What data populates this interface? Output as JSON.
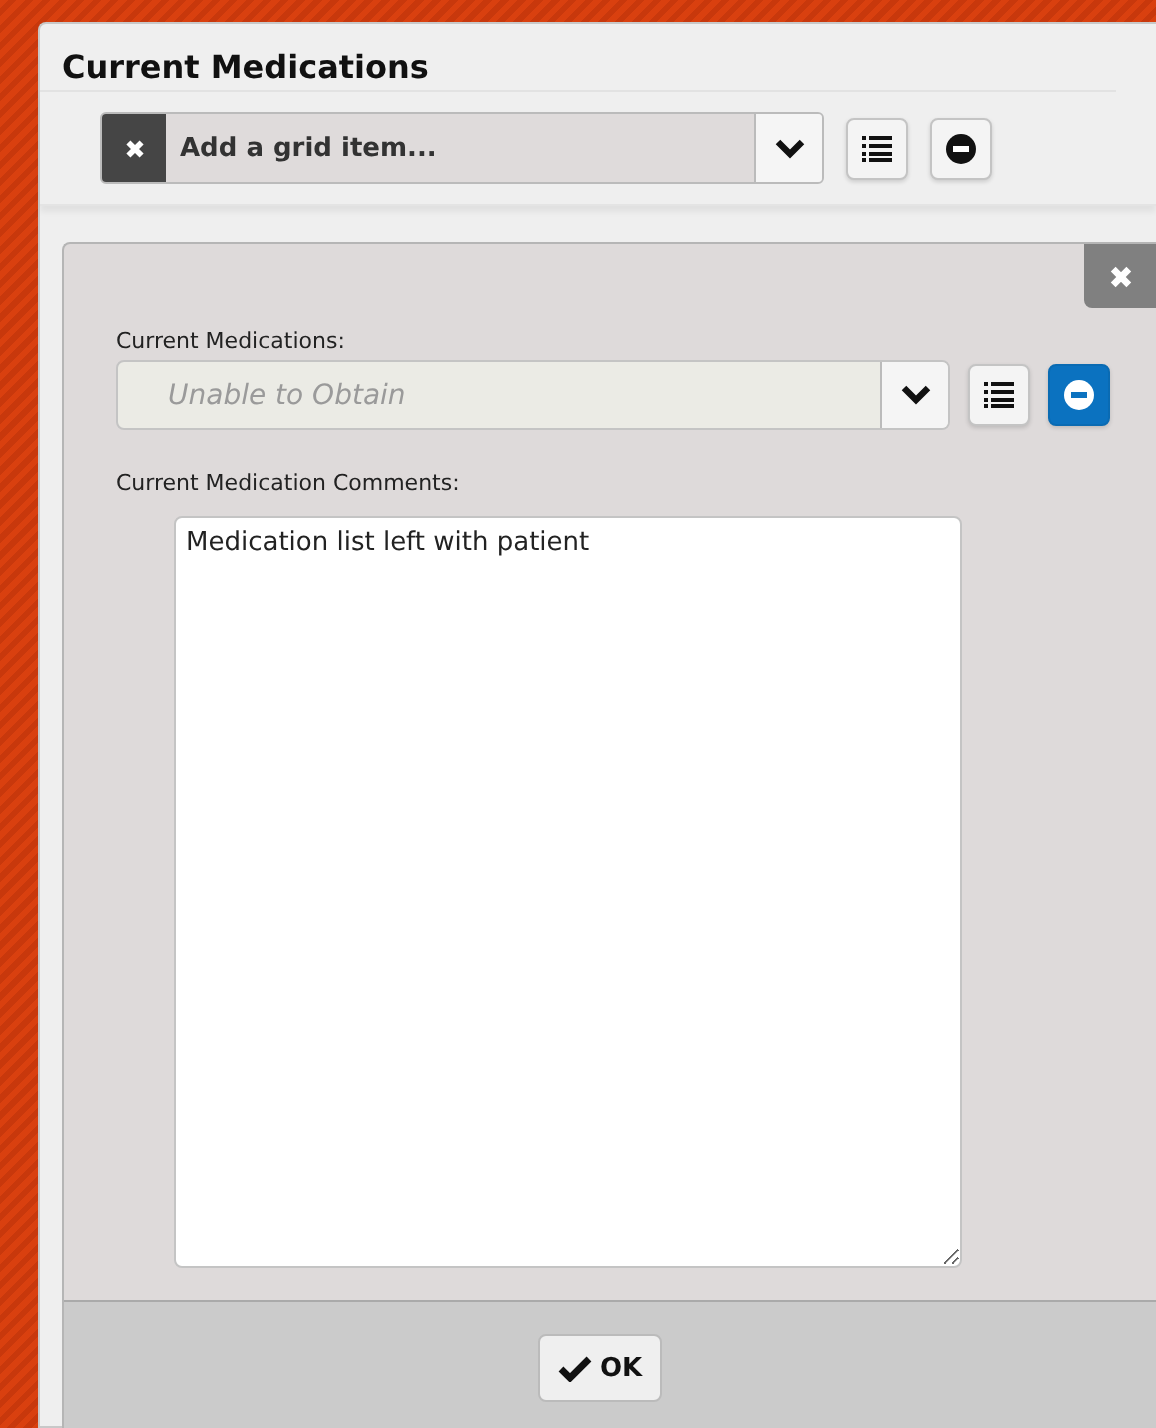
{
  "section": {
    "title": "Current Medications"
  },
  "add_bar": {
    "placeholder": "Add a grid item..."
  },
  "item": {
    "field_label": "Current Medications:",
    "select_value": "Unable to Obtain",
    "remove_active": true,
    "comments_label": "Current Medication Comments:",
    "comments_value": "Medication list left with patient"
  },
  "footer": {
    "ok_label": "OK"
  }
}
